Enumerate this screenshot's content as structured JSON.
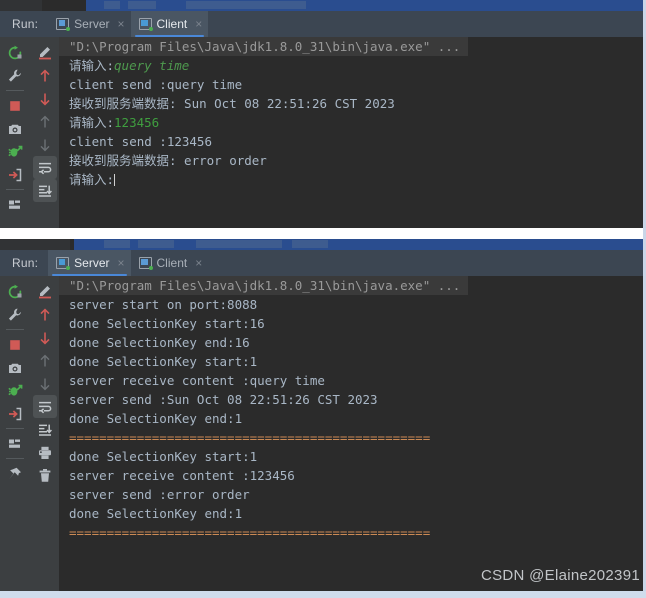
{
  "app": {
    "tool_window": "Run:",
    "watermark": "CSDN @Elaine202391"
  },
  "panels": [
    {
      "id": "client-panel",
      "run_label": "Run:",
      "tabs": [
        {
          "label": "Server",
          "close": "×",
          "active": false,
          "icon": "run-configuration-icon"
        },
        {
          "label": "Client",
          "close": "×",
          "active": true,
          "icon": "run-configuration-icon"
        }
      ],
      "console": {
        "command_line": "\"D:\\Program Files\\Java\\jdk1.8.0_31\\bin\\java.exe\" ...",
        "lines": [
          {
            "text": "请输入:",
            "input": "query time",
            "style": "prompt-input"
          },
          {
            "text": "client send :query time",
            "style": "plain"
          },
          {
            "text": "接收到服务端数据: Sun Oct 08 22:51:26 CST 2023",
            "style": "plain"
          },
          {
            "text": "请输入:",
            "input": "123456",
            "style": "prompt-input"
          },
          {
            "text": "client send :123456",
            "style": "plain"
          },
          {
            "text": "接收到服务端数据: error order",
            "style": "plain"
          },
          {
            "text": "请输入:",
            "input": "",
            "style": "prompt-caret"
          }
        ]
      }
    },
    {
      "id": "server-panel",
      "run_label": "Run:",
      "tabs": [
        {
          "label": "Server",
          "close": "×",
          "active": true,
          "icon": "run-configuration-icon"
        },
        {
          "label": "Client",
          "close": "×",
          "active": false,
          "icon": "run-configuration-icon"
        }
      ],
      "console": {
        "command_line": "\"D:\\Program Files\\Java\\jdk1.8.0_31\\bin\\java.exe\" ...",
        "lines": [
          {
            "text": "server start on port:8088",
            "style": "plain"
          },
          {
            "text": "done SelectionKey start:16",
            "style": "plain"
          },
          {
            "text": "done SelectionKey end:16",
            "style": "plain"
          },
          {
            "text": "done SelectionKey start:1",
            "style": "plain"
          },
          {
            "text": "server receive content :query time",
            "style": "plain"
          },
          {
            "text": "server send :Sun Oct 08 22:51:26 CST 2023",
            "style": "plain"
          },
          {
            "text": "done SelectionKey end:1",
            "style": "plain"
          },
          {
            "text": "================================================",
            "style": "separator"
          },
          {
            "text": "done SelectionKey start:1",
            "style": "plain"
          },
          {
            "text": "server receive content :123456",
            "style": "plain"
          },
          {
            "text": "server send :error order",
            "style": "plain"
          },
          {
            "text": "done SelectionKey end:1",
            "style": "plain"
          },
          {
            "text": "================================================",
            "style": "separator"
          }
        ]
      }
    }
  ],
  "toolbar_left": [
    {
      "name": "rerun-icon",
      "enabled": true
    },
    {
      "name": "edit-configuration-wrench-icon",
      "enabled": true
    },
    {
      "name": "stop-icon",
      "enabled": true
    },
    {
      "name": "screenshot-camera-icon",
      "enabled": true
    },
    {
      "name": "attach-debugger-icon",
      "enabled": true
    },
    {
      "name": "export-icon",
      "enabled": true
    },
    {
      "name": "layout-icon",
      "enabled": true
    },
    {
      "name": "pin-tab-icon",
      "enabled": true
    }
  ],
  "toolbar_right": [
    {
      "name": "highlight-marker-icon",
      "enabled": true
    },
    {
      "name": "up-arrow-icon",
      "enabled": true
    },
    {
      "name": "down-arrow-icon",
      "enabled": true
    },
    {
      "name": "up-arrow-dim-icon",
      "enabled": false
    },
    {
      "name": "down-arrow-dim-icon",
      "enabled": false
    },
    {
      "name": "soft-wrap-icon",
      "enabled": true,
      "framed": true
    },
    {
      "name": "scroll-to-end-icon",
      "enabled": true,
      "framed": true
    },
    {
      "name": "print-icon",
      "enabled": true
    },
    {
      "name": "clear-all-trash-icon",
      "enabled": true
    }
  ],
  "colors": {
    "console_bg": "#2b2b2b",
    "tabbar_bg": "#3c4652",
    "toolbar_bg": "#3c3f41",
    "text": "#a9b7c6",
    "input_green": "#4e9a4e",
    "separator_orange": "#cc8a54",
    "tab_underline": "#4a88d8",
    "editor_blue": "#2a4d8f"
  }
}
